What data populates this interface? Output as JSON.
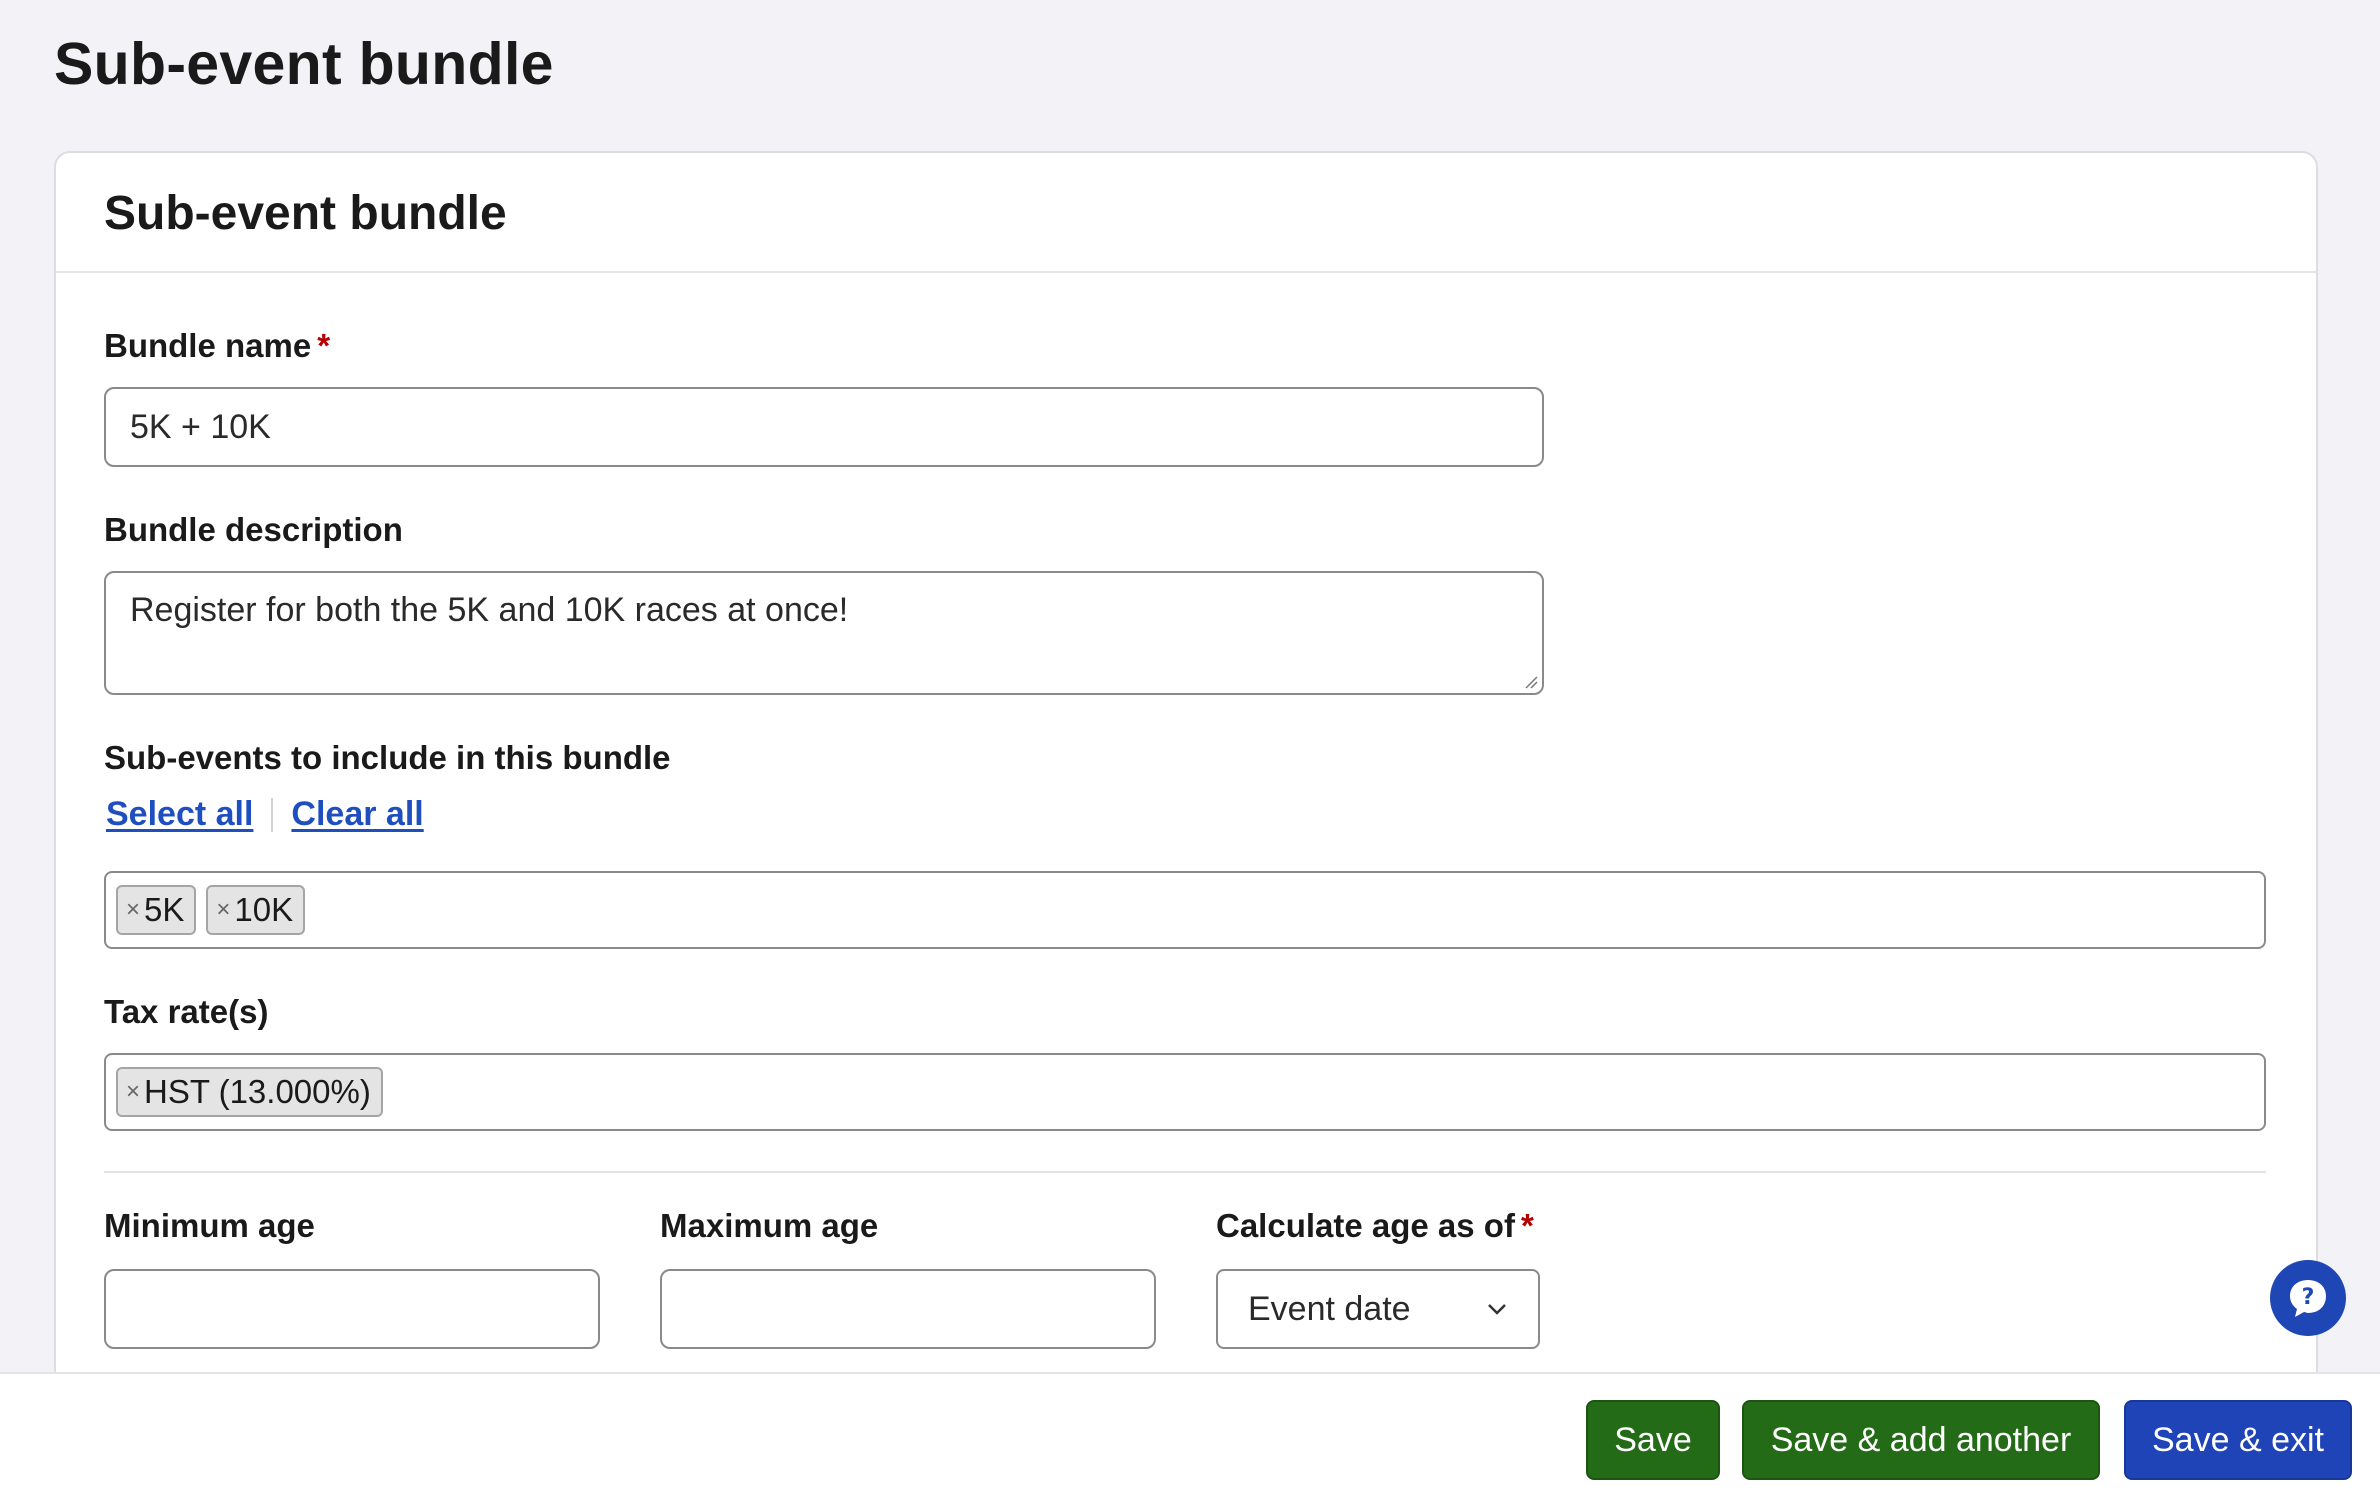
{
  "page": {
    "title": "Sub-event bundle"
  },
  "card": {
    "title": "Sub-event bundle"
  },
  "bundle_name": {
    "label": "Bundle name",
    "required_mark": "*",
    "value": "5K + 10K"
  },
  "bundle_description": {
    "label": "Bundle description",
    "value": "Register for both the 5K and 10K races at once!"
  },
  "sub_events": {
    "label": "Sub-events to include in this bundle",
    "select_all": "Select all",
    "clear_all": "Clear all",
    "selected": [
      {
        "remove": "×",
        "label": "5K"
      },
      {
        "remove": "×",
        "label": "10K"
      }
    ]
  },
  "tax_rates": {
    "label": "Tax rate(s)",
    "selected": [
      {
        "remove": "×",
        "label": "HST (13.000%)"
      }
    ]
  },
  "minimum_age": {
    "label": "Minimum age",
    "value": ""
  },
  "maximum_age": {
    "label": "Maximum age",
    "value": ""
  },
  "calculate_age": {
    "label": "Calculate age as of",
    "required_mark": "*",
    "value": "Event date"
  },
  "footer": {
    "save": "Save",
    "save_add_another": "Save & add another",
    "save_exit": "Save & exit"
  },
  "icons": {
    "help": "help-chat-icon",
    "dropdown": "chevron-down-icon",
    "remove": "close-icon"
  },
  "colors": {
    "primary_green": "#246b17",
    "primary_blue": "#1f44b8",
    "link": "#1f4fbf",
    "required": "#b30000"
  }
}
